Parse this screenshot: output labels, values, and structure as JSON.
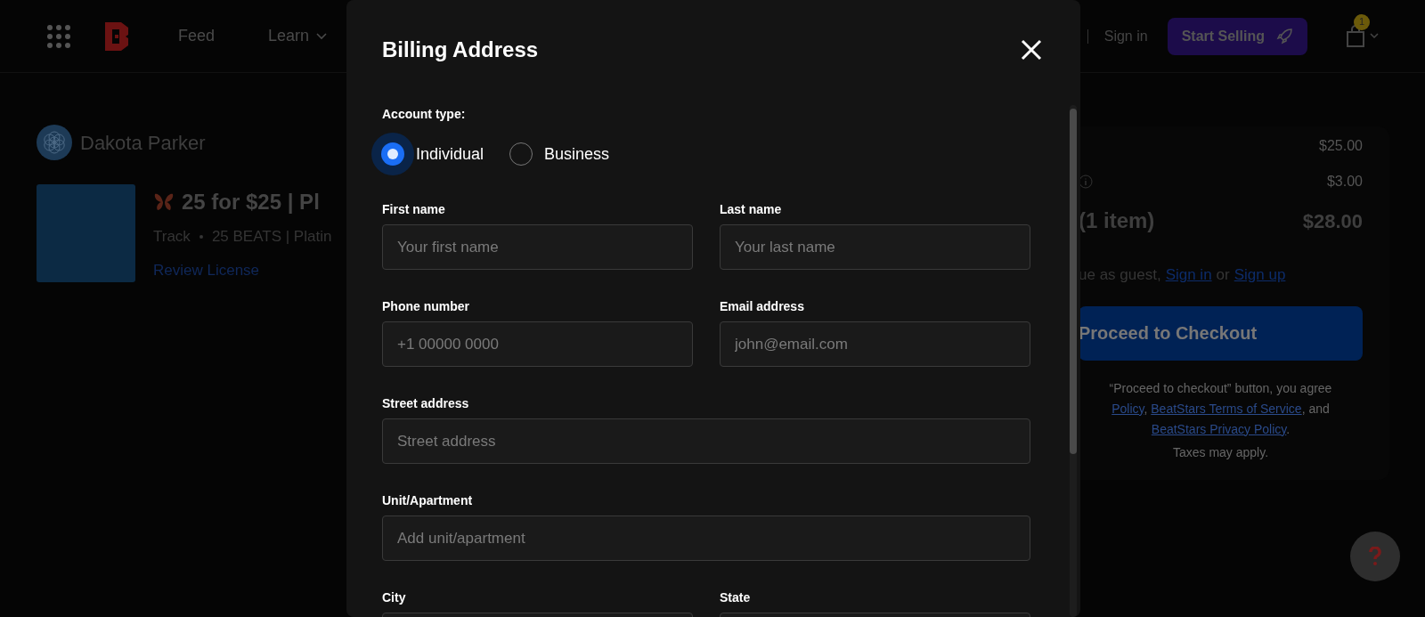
{
  "nav": {
    "items": [
      {
        "label": "Feed",
        "kind": "link"
      },
      {
        "label": "Learn",
        "kind": "dropdown"
      }
    ],
    "sign_in": "Sign in",
    "start_selling": "Start Selling",
    "cart_count": "1"
  },
  "seller": {
    "name": "Dakota Parker"
  },
  "product": {
    "title": "25 for $25 | Pl",
    "type": "Track",
    "subtitle": "25 BEATS | Platin",
    "link": "Review License"
  },
  "summary": {
    "rows": [
      {
        "amount": "$25.00",
        "info": false
      },
      {
        "amount": "$3.00",
        "info": true
      }
    ],
    "total_label": "(1 item)",
    "total": "$28.00",
    "guest_text": "ue as guest,",
    "sign_in": "Sign in",
    "or": "or",
    "sign_up": "Sign up",
    "checkout_button": "Proceed to Checkout",
    "legal": {
      "line_1": "“Proceed to checkout” button, you agree",
      "policy_link": "Policy",
      "separator": ",",
      "terms_link": "BeatStars Terms of Service",
      "and_text": ", and",
      "privacy_link": "BeatStars Privacy Policy",
      "end": "."
    },
    "taxes": "Taxes may apply."
  },
  "modal": {
    "title": "Billing Address",
    "account_type": {
      "label": "Account type:",
      "options": [
        {
          "label": "Individual",
          "selected": true
        },
        {
          "label": "Business",
          "selected": false
        }
      ]
    },
    "fields": [
      {
        "label": "First name",
        "placeholder": "Your first name",
        "kind": "half"
      },
      {
        "label": "Last name",
        "placeholder": "Your last name",
        "kind": "half"
      },
      {
        "label": "Phone number",
        "placeholder": "+1 00000 0000",
        "kind": "half"
      },
      {
        "label": "Email address",
        "placeholder": "john@email.com",
        "kind": "half"
      },
      {
        "label": "Street address",
        "placeholder": "Street address",
        "kind": "full"
      },
      {
        "label": "Unit/Apartment",
        "placeholder": "Add unit/apartment",
        "kind": "full"
      },
      {
        "label": "City",
        "kind": "half"
      },
      {
        "label": "State",
        "kind": "half"
      }
    ]
  }
}
